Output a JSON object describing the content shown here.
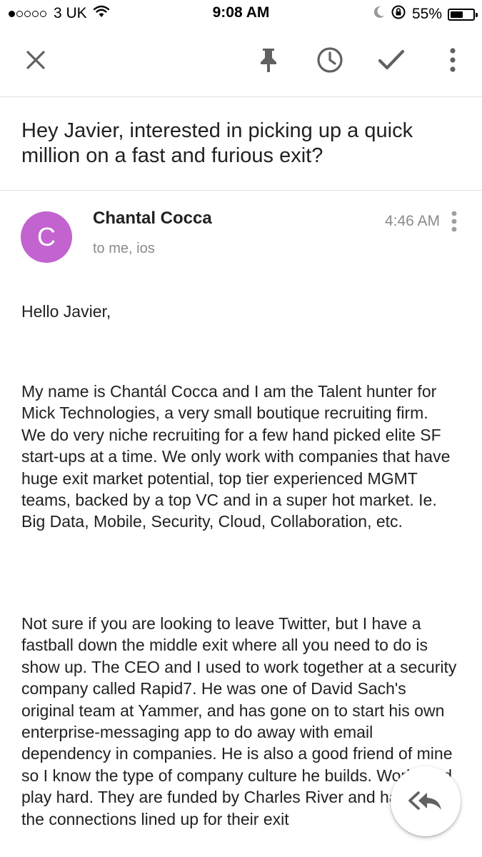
{
  "status_bar": {
    "carrier": "3 UK",
    "time": "9:08 AM",
    "battery_text": "55%",
    "battery_level": 0.55,
    "signal_bars": 1,
    "signal_total": 5,
    "icons": [
      "wifi-icon",
      "moon-icon",
      "rotation-lock-icon",
      "battery-icon"
    ]
  },
  "toolbar": {
    "buttons": [
      "close-icon",
      "pin-icon",
      "snooze-clock-icon",
      "done-check-icon",
      "more-vert-icon"
    ]
  },
  "email": {
    "subject": "Hey Javier, interested in picking up a quick million on a fast and furious exit?",
    "sender": {
      "name": "Chantal Cocca",
      "initial": "C",
      "avatar_color": "#c263d0"
    },
    "recipients": "to me, ios",
    "time": "4:46 AM",
    "greeting": "Hello Javier,",
    "paragraphs": [
      "My name is Chantál Cocca and I am the Talent hunter for Mick Technologies, a very small boutique recruiting firm. We do very niche recruiting for a few hand picked elite SF start-ups at a time. We only work with companies that have huge exit market potential, top tier experienced MGMT teams, backed by a top VC and in a super hot market. Ie. Big Data, Mobile, Security, Cloud, Collaboration, etc.",
      "Not sure if you are looking to leave Twitter, but I have a fastball down the middle exit where all you need to do is show up. The CEO and I used to work together at a security company called Rapid7. He was one of David Sach's original team at Yammer, and has gone on to start his own enterprise-messaging app to do away with email dependency in companies. He is also a good friend of mine so I know the type of company culture he builds. Work hard play hard. They are funded by Charles River and have all the connections lined up for their exit"
    ]
  },
  "fab": {
    "icon": "reply-all-icon"
  },
  "colors": {
    "icon": "#616161",
    "secondary_text": "#8a8a8a",
    "divider": "#e0e0e0"
  }
}
